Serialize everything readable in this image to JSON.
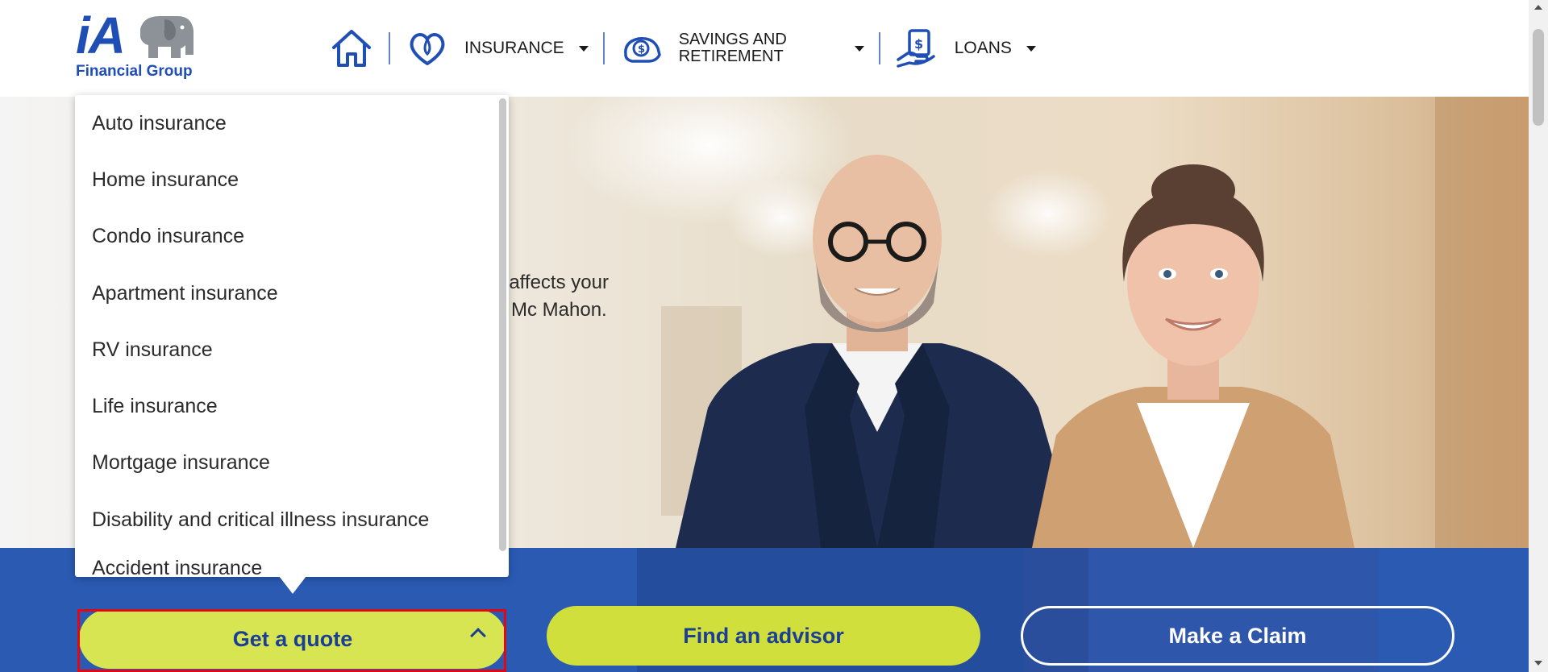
{
  "header": {
    "logo": {
      "brand": "iA",
      "name": "Financial Group",
      "icon": "elephant-logo-icon"
    },
    "nav": [
      {
        "id": "home",
        "icon": "home-icon",
        "label": ""
      },
      {
        "id": "insurance",
        "icon": "heart-icon",
        "label": "INSURANCE"
      },
      {
        "id": "savings",
        "icon": "piggy-bank-dollar-icon",
        "label": "SAVINGS AND RETIREMENT"
      },
      {
        "id": "loans",
        "icon": "hand-dollar-icon",
        "label": "LOANS"
      }
    ]
  },
  "hero": {
    "text_line1": "t affects your",
    "text_line2": "Mc Mahon."
  },
  "dropdown": {
    "items": [
      "Auto insurance",
      "Home insurance",
      "Condo insurance",
      "Apartment insurance",
      "RV insurance",
      "Life insurance",
      "Mortgage insurance",
      "Disability and critical illness insurance",
      "Accident insurance"
    ]
  },
  "actions": {
    "quote_label": "Get a quote",
    "advisor_label": "Find an advisor",
    "claim_label": "Make a Claim"
  },
  "colors": {
    "brand_blue": "#1f4eb4",
    "band_blue": "#2a5ab2",
    "lime": "#d8e553",
    "highlight_red": "#e30613"
  }
}
